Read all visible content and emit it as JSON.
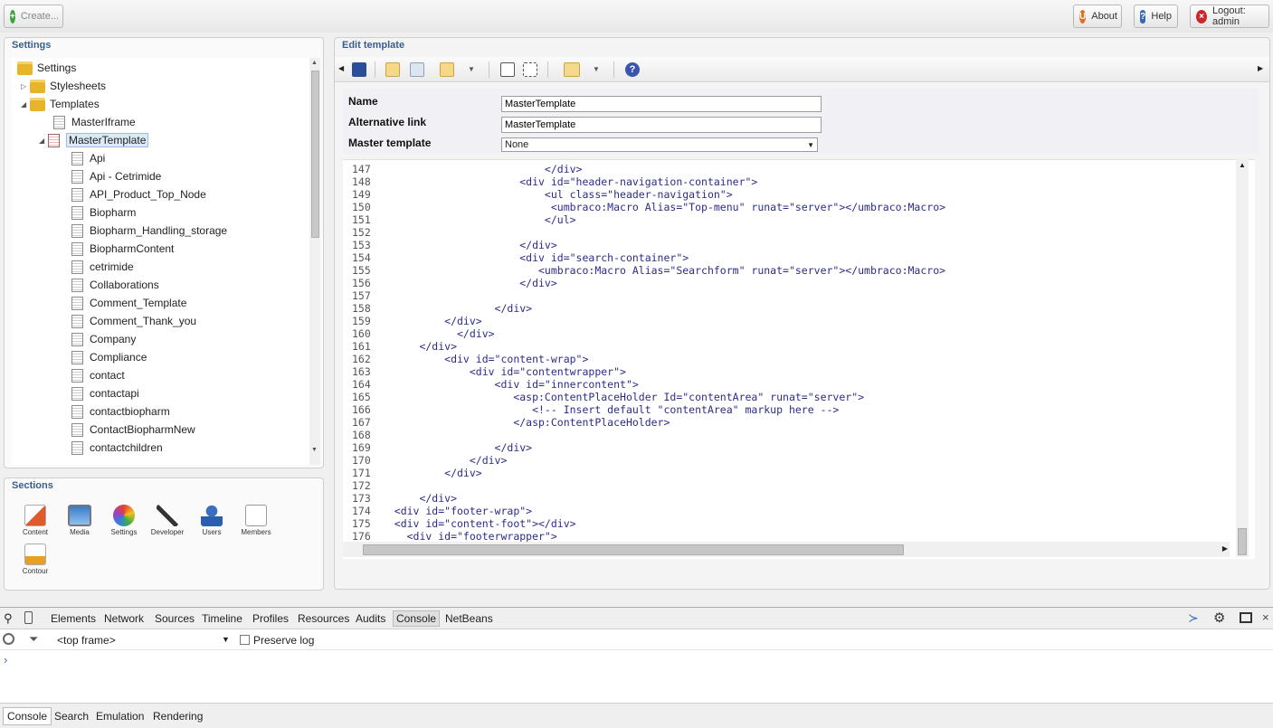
{
  "topbar": {
    "create_label": "Create...",
    "about_label": "About",
    "help_label": "Help",
    "logout_label": "Logout: admin"
  },
  "settings_panel": {
    "title": "Settings",
    "tree": [
      {
        "label": "Settings"
      },
      {
        "label": "Stylesheets"
      },
      {
        "label": "Templates"
      },
      {
        "label": "MasterIframe"
      },
      {
        "label": "MasterTemplate"
      },
      {
        "label": "Api"
      },
      {
        "label": "Api - Cetrimide"
      },
      {
        "label": "API_Product_Top_Node"
      },
      {
        "label": "Biopharm"
      },
      {
        "label": "Biopharm_Handling_storage"
      },
      {
        "label": "BiopharmContent"
      },
      {
        "label": "cetrimide"
      },
      {
        "label": "Collaborations"
      },
      {
        "label": "Comment_Template"
      },
      {
        "label": "Comment_Thank_you"
      },
      {
        "label": "Company"
      },
      {
        "label": "Compliance"
      },
      {
        "label": "contact"
      },
      {
        "label": "contactapi"
      },
      {
        "label": "contactbiopharm"
      },
      {
        "label": "ContactBiopharmNew"
      },
      {
        "label": "contactchildren"
      }
    ]
  },
  "sections_panel": {
    "title": "Sections",
    "items": [
      {
        "label": "Content",
        "icon": "content-icon"
      },
      {
        "label": "Media",
        "icon": "media-icon"
      },
      {
        "label": "Settings",
        "icon": "settings-icon"
      },
      {
        "label": "Developer",
        "icon": "developer-icon"
      },
      {
        "label": "Users",
        "icon": "users-icon"
      },
      {
        "label": "Members",
        "icon": "members-icon"
      },
      {
        "label": "Contour",
        "icon": "contour-icon"
      }
    ]
  },
  "edit_panel": {
    "title": "Edit template",
    "name_label": "Name",
    "name_value": "MasterTemplate",
    "alt_link_label": "Alternative link",
    "alt_link_value": "MasterTemplate",
    "master_label": "Master template",
    "master_value": "None",
    "code_lines": [
      {
        "n": "147",
        "text": "                           </div>"
      },
      {
        "n": "148",
        "text": "                       <div id=\"header-navigation-container\">"
      },
      {
        "n": "149",
        "text": "                           <ul class=\"header-navigation\">"
      },
      {
        "n": "150",
        "text": "                            <umbraco:Macro Alias=\"Top-menu\" runat=\"server\"></umbraco:Macro>"
      },
      {
        "n": "151",
        "text": "                           </ul>"
      },
      {
        "n": "152",
        "text": ""
      },
      {
        "n": "153",
        "text": "                       </div>"
      },
      {
        "n": "154",
        "text": "                       <div id=\"search-container\">"
      },
      {
        "n": "155",
        "text": "                          <umbraco:Macro Alias=\"Searchform\" runat=\"server\"></umbraco:Macro>"
      },
      {
        "n": "156",
        "text": "                       </div>"
      },
      {
        "n": "157",
        "text": ""
      },
      {
        "n": "158",
        "text": "                   </div>"
      },
      {
        "n": "159",
        "text": "           </div>"
      },
      {
        "n": "160",
        "text": "             </div>"
      },
      {
        "n": "161",
        "text": "       </div>"
      },
      {
        "n": "162",
        "text": "           <div id=\"content-wrap\">"
      },
      {
        "n": "163",
        "text": "               <div id=\"contentwrapper\">"
      },
      {
        "n": "164",
        "text": "                   <div id=\"innercontent\">"
      },
      {
        "n": "165",
        "text": "                      <asp:ContentPlaceHolder Id=\"contentArea\" runat=\"server\">"
      },
      {
        "n": "166",
        "text": "                         <!-- Insert default \"contentArea\" markup here -->"
      },
      {
        "n": "167",
        "text": "                      </asp:ContentPlaceHolder>"
      },
      {
        "n": "168",
        "text": ""
      },
      {
        "n": "169",
        "text": "                   </div>"
      },
      {
        "n": "170",
        "text": "               </div>"
      },
      {
        "n": "171",
        "text": "           </div>"
      },
      {
        "n": "172",
        "text": ""
      },
      {
        "n": "173",
        "text": "       </div>"
      },
      {
        "n": "174",
        "text": "   <div id=\"footer-wrap\">"
      },
      {
        "n": "175",
        "text": "   <div id=\"content-foot\"></div>"
      },
      {
        "n": "176",
        "text": "     <div id=\"footerwrapper\">"
      }
    ]
  },
  "devtools": {
    "tabs": [
      "Elements",
      "Network",
      "Sources",
      "Timeline",
      "Profiles",
      "Resources",
      "Audits",
      "Console",
      "NetBeans"
    ],
    "active_tab": "Console",
    "frame_select": "<top frame>",
    "preserve_log": "Preserve log",
    "prompt": "›",
    "bottom_tabs": [
      "Console",
      "Search",
      "Emulation",
      "Rendering"
    ]
  }
}
